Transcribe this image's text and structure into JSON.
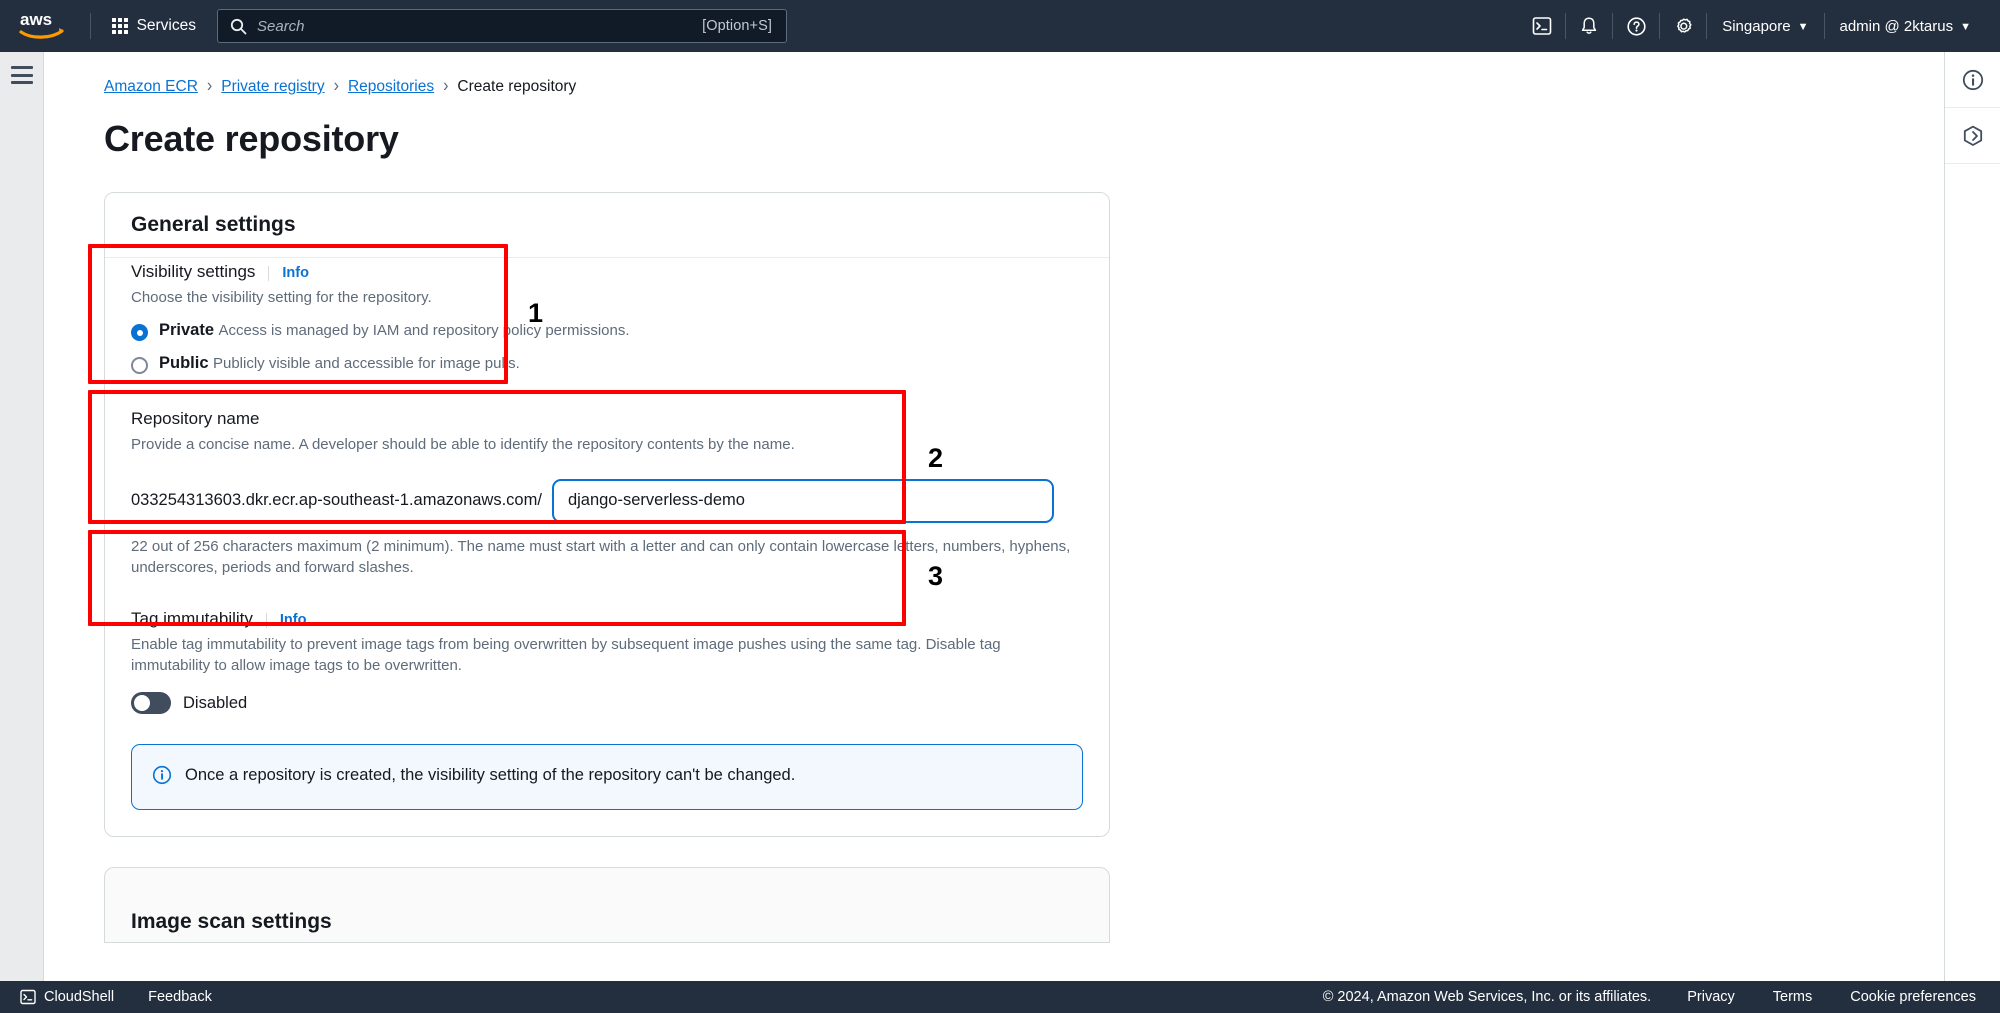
{
  "topnav": {
    "logo_alt": "aws",
    "services_label": "Services",
    "search": {
      "placeholder": "Search",
      "value": "",
      "shortcut": "[Option+S]"
    },
    "icons": [
      {
        "name": "cloudshell-icon"
      },
      {
        "name": "notifications-bell-icon"
      },
      {
        "name": "help-question-icon"
      },
      {
        "name": "settings-gear-icon"
      }
    ],
    "region_label": "Singapore",
    "account_label": "admin @ 2ktarus",
    "caret": "▼"
  },
  "breadcrumb": [
    {
      "label": "Amazon ECR",
      "link": true
    },
    {
      "label": "Private registry",
      "link": true
    },
    {
      "label": "Repositories",
      "link": true
    },
    {
      "label": "Create repository",
      "link": false
    }
  ],
  "breadcrumb_separator": "›",
  "page": {
    "title": "Create repository"
  },
  "general_settings": {
    "heading": "General settings",
    "visibility": {
      "label": "Visibility settings",
      "info_label": "Info",
      "description": "Choose the visibility setting for the repository.",
      "options": [
        {
          "label": "Private",
          "description": "Access is managed by IAM and repository policy permissions.",
          "selected": true
        },
        {
          "label": "Public",
          "description": "Publicly visible and accessible for image pulls.",
          "selected": false
        }
      ]
    },
    "repository_name": {
      "label": "Repository name",
      "description": "Provide a concise name. A developer should be able to identify the repository contents by the name.",
      "prefix": "033254313603.dkr.ecr.ap-southeast-1.amazonaws.com/",
      "value": "django-serverless-demo",
      "placeholder": "",
      "hint": "22 out of 256 characters maximum (2 minimum). The name must start with a letter and can only contain lowercase letters, numbers, hyphens, underscores, periods and forward slashes."
    },
    "tag_immutability": {
      "label": "Tag immutability",
      "info_label": "Info",
      "description": "Enable tag immutability to prevent image tags from being overwritten by subsequent image pushes using the same tag. Disable tag immutability to allow image tags to be overwritten.",
      "toggle_state_label": "Disabled",
      "toggle_on": false
    },
    "alert": {
      "icon": "info-circle-icon",
      "text": "Once a repository is created, the visibility setting of the repository can't be changed."
    }
  },
  "image_scan_settings": {
    "heading": "Image scan settings"
  },
  "annotations": [
    {
      "number": "1"
    },
    {
      "number": "2"
    },
    {
      "number": "3"
    }
  ],
  "right_rail": {
    "icons": [
      {
        "name": "info-panel-icon"
      },
      {
        "name": "shortcuts-hexagon-icon"
      }
    ]
  },
  "footer": {
    "cloudshell_label": "CloudShell",
    "feedback_label": "Feedback",
    "copyright": "© 2024, Amazon Web Services, Inc. or its affiliates.",
    "links": [
      {
        "label": "Privacy"
      },
      {
        "label": "Terms"
      },
      {
        "label": "Cookie preferences"
      }
    ]
  },
  "colors": {
    "nav_bg": "#232f3e",
    "link_blue": "#0972d3",
    "annotation_red": "#ff0000",
    "alert_bg": "#f2f8fd"
  }
}
